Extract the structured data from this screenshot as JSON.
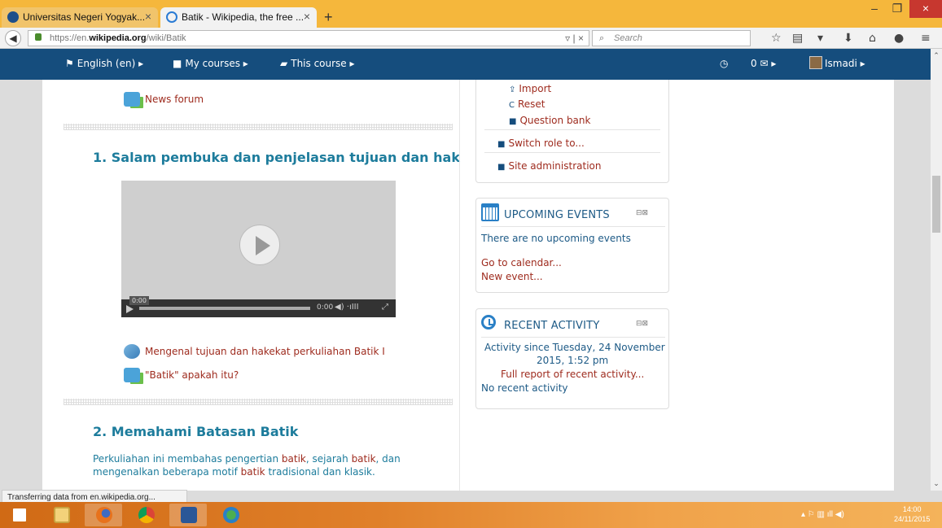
{
  "browser": {
    "tabs": [
      {
        "title": "Universitas Negeri Yogyak...",
        "close": "×"
      },
      {
        "title": "Batik - Wikipedia, the free ...",
        "close": "×"
      }
    ],
    "new_tab": "+",
    "window_controls": {
      "minimize": "–",
      "maximize": "❐",
      "close": "×"
    },
    "url_prefix": "https://en.",
    "url_domain": "wikipedia.org",
    "url_path": "/wiki/Batik",
    "url_controls": "▿  |  ×",
    "search_placeholder": "Search",
    "status_text": "Transferring data from en.wikipedia.org..."
  },
  "moodle_nav": {
    "language": "English (en) ▸",
    "my_courses": "My courses ▸",
    "this_course": "This course ▸",
    "messages": "0 ✉  ▸",
    "user": "Ismadi ▸"
  },
  "main": {
    "news_forum": "News forum",
    "section1_title": "1. Salam pembuka dan penjelasan tujuan dan hak",
    "video": {
      "time_start": "0:00",
      "time_end": "0:00"
    },
    "activity1": "Mengenal tujuan dan hakekat perkuliahan Batik I",
    "activity2": "\"Batik\" apakah itu?",
    "section2_title": "2. Memahami Batasan Batik",
    "para": {
      "t1": "Perkuliahan ini membahas pengertian ",
      "l1": "batik",
      "t2": ", sejarah ",
      "l2": "batik",
      "t3": ", dan mengenalkan beberapa motif ",
      "l3": "batik",
      "t4": " tradisional dan klasik."
    }
  },
  "admin_block": {
    "import": "Import",
    "reset": "Reset",
    "question_bank": "Question bank",
    "switch_role": "Switch role to...",
    "site_admin": "Site administration"
  },
  "upcoming_events": {
    "title": "UPCOMING EVENTS",
    "empty": "There are no upcoming events",
    "go_calendar": "Go to calendar...",
    "new_event": "New event..."
  },
  "recent_activity": {
    "title": "RECENT ACTIVITY",
    "since_line1": "Activity since Tuesday, 24 November",
    "since_line2": "2015, 1:52 pm",
    "full_report": "Full report of recent activity...",
    "none": "No recent activity"
  },
  "taskbar": {
    "time": "14:00",
    "date": "24/11/2015"
  },
  "colors": {
    "titlebar": "#f5b73c",
    "moodle_header": "#154d7d",
    "link": "#9e2b1e",
    "heading": "#1d7c9c"
  }
}
